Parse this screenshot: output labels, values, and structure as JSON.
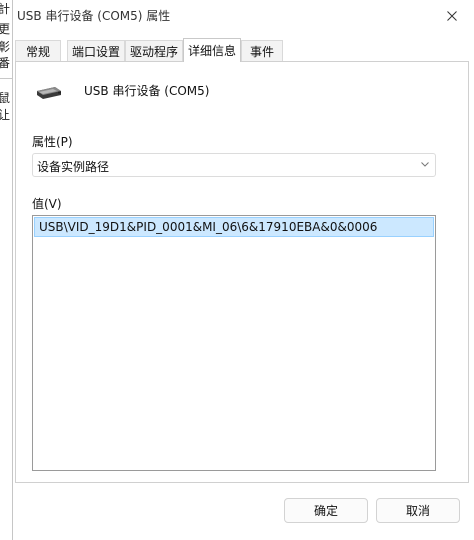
{
  "background_window": {
    "fragments": [
      "計",
      "更",
      "彰",
      "番",
      "鼠",
      "让"
    ]
  },
  "dialog": {
    "title": "USB 串行设备 (COM5) 属性",
    "tabs": [
      "常规",
      "端口设置",
      "驱动程序",
      "详细信息",
      "事件"
    ],
    "active_tab_index": 3,
    "device": {
      "icon": "usb-serial-device-icon",
      "name": "USB 串行设备 (COM5)"
    },
    "property": {
      "label": "属性(P)",
      "selected": "设备实例路径"
    },
    "value": {
      "label": "值(V)",
      "items": [
        "USB\\VID_19D1&PID_0001&MI_06\\6&17910EBA&0&0006"
      ]
    },
    "buttons": {
      "ok": "确定",
      "cancel": "取消"
    }
  }
}
